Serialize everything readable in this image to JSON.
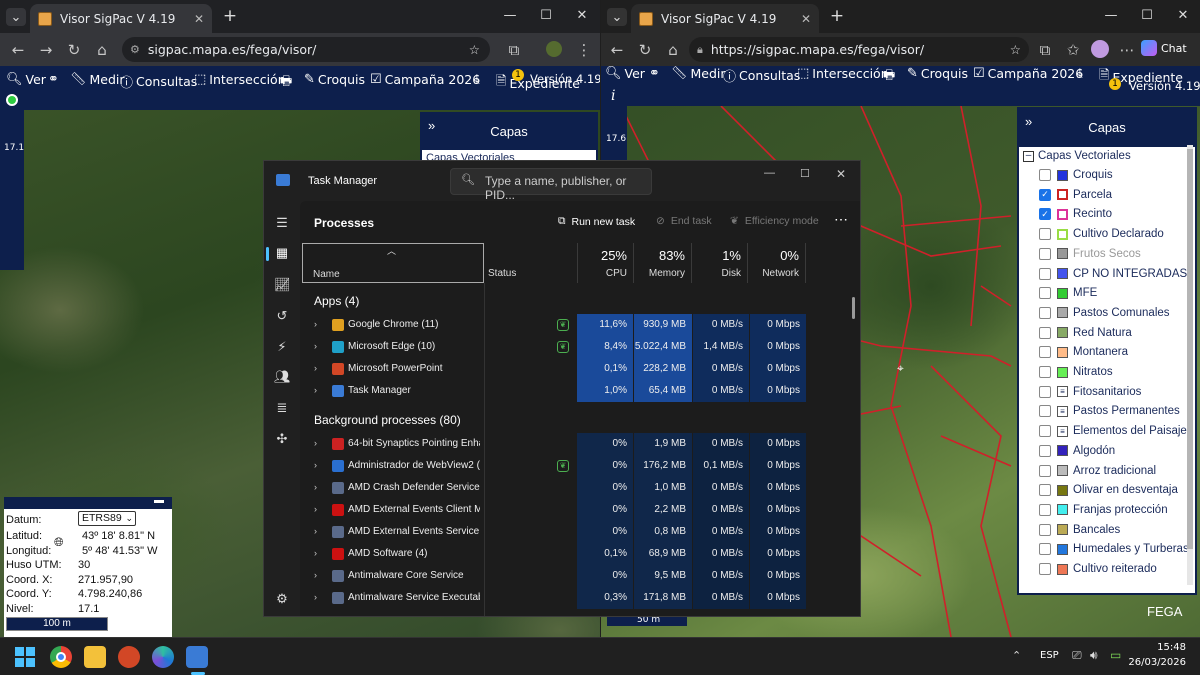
{
  "left_browser": {
    "tab_title": "Visor SigPac V 4.19",
    "url": "sigpac.mapa.es/fega/visor/",
    "toolbar": {
      "ver": "Ver",
      "medir": "Medir",
      "consultas": "Consultas",
      "interseccion": "Intersección",
      "croquis": "Croquis",
      "campana": "Campaña 2026",
      "expediente": "Expediente",
      "version": "Versión 4.19"
    },
    "zoom_level": "17.1",
    "capas_title": "Capas",
    "capas_first": "Capas Vectoriales",
    "scale_bar": "100 m",
    "coords": {
      "datum_label": "Datum:",
      "datum_value": "ETRS89",
      "lat_label": "Latitud:",
      "lat_value": "43º 18' 8.81\" N",
      "lon_label": "Longitud:",
      "lon_value": "5º 48' 41.53\" W",
      "huso_label": "Huso UTM:",
      "huso_value": "30",
      "x_label": "Coord. X:",
      "x_value": "271.957,90",
      "y_label": "Coord. Y:",
      "y_value": "4.798.240,86",
      "nivel_label": "Nivel:",
      "nivel_value": "17.1"
    }
  },
  "right_browser": {
    "tab_title": "Visor SigPac V 4.19",
    "url": "https://sigpac.mapa.es/fega/visor/",
    "copilot": "Chat",
    "toolbar": {
      "ver": "Ver",
      "medir": "Medir",
      "consultas": "Consultas",
      "interseccion": "Intersección",
      "croquis": "Croquis",
      "campana": "Campaña 2026",
      "expediente": "Expediente",
      "version": "Versión 4.19"
    },
    "zoom_level": "17.6",
    "scale_bar": "50 m",
    "watermark": "FEGA",
    "capas": {
      "title": "Capas",
      "group": "Capas Vectoriales",
      "layers": [
        {
          "name": "Croquis",
          "checked": false,
          "color": "#2233dd",
          "filled": true
        },
        {
          "name": "Parcela",
          "checked": true,
          "color": "#cc2222",
          "filled": false
        },
        {
          "name": "Recinto",
          "checked": true,
          "color": "#dd3399",
          "filled": false
        },
        {
          "name": "Cultivo Declarado",
          "checked": false,
          "color": "#99dd44",
          "filled": false
        },
        {
          "name": "Frutos Secos",
          "checked": false,
          "color": "#999999",
          "filled": true,
          "disabled": true
        },
        {
          "name": "CP NO INTEGRADAS",
          "checked": false,
          "color": "#4455ee",
          "filled": true
        },
        {
          "name": "MFE",
          "checked": false,
          "color": "#33cc33",
          "filled": true
        },
        {
          "name": "Pastos Comunales",
          "checked": false,
          "color": "#aaaaaa",
          "filled": true
        },
        {
          "name": "Red Natura",
          "checked": false,
          "color": "#88aa66",
          "filled": true
        },
        {
          "name": "Montanera",
          "checked": false,
          "color": "#ffbb88",
          "filled": true
        },
        {
          "name": "Nitratos",
          "checked": false,
          "color": "#66ee55",
          "filled": true
        },
        {
          "name": "Fitosanitarios",
          "checked": false,
          "color": "#ffffff",
          "filled": true,
          "list": true
        },
        {
          "name": "Pastos Permanentes",
          "checked": false,
          "color": "#ffffff",
          "filled": true,
          "list": true
        },
        {
          "name": "Elementos del Paisaje",
          "checked": false,
          "color": "#ffffff",
          "filled": true,
          "list": true
        },
        {
          "name": "Algodón",
          "checked": false,
          "color": "#3322bb",
          "filled": true
        },
        {
          "name": "Arroz tradicional",
          "checked": false,
          "color": "#bbbbbb",
          "filled": true
        },
        {
          "name": "Olivar en desventaja",
          "checked": false,
          "color": "#777711",
          "filled": true
        },
        {
          "name": "Franjas protección",
          "checked": false,
          "color": "#44eeee",
          "filled": true
        },
        {
          "name": "Bancales",
          "checked": false,
          "color": "#bbaa55",
          "filled": true
        },
        {
          "name": "Humedales y Turberas",
          "checked": false,
          "color": "#2277dd",
          "filled": true
        },
        {
          "name": "Cultivo reiterado",
          "checked": false,
          "color": "#ee7755",
          "filled": true
        }
      ]
    }
  },
  "task_manager": {
    "title": "Task Manager",
    "search_placeholder": "Type a name, publisher, or PID...",
    "section": "Processes",
    "run_new_task": "Run new task",
    "end_task": "End task",
    "efficiency_mode": "Efficiency mode",
    "columns": {
      "name": "Name",
      "status": "Status",
      "cpu_pct": "25%",
      "cpu": "CPU",
      "mem_pct": "83%",
      "mem": "Memory",
      "disk_pct": "1%",
      "disk": "Disk",
      "net_pct": "0%",
      "net": "Network"
    },
    "apps_header": "Apps (4)",
    "bg_header": "Background processes (80)",
    "apps": [
      {
        "name": "Google Chrome (11)",
        "icon": "chrome-icon",
        "color": "#e0a020",
        "eff": true,
        "cpu": "11,6%",
        "mem": "930,9 MB",
        "disk": "0 MB/s",
        "net": "0 Mbps"
      },
      {
        "name": "Microsoft Edge (10)",
        "icon": "edge-icon",
        "color": "#1fa0c8",
        "eff": true,
        "cpu": "8,4%",
        "mem": "5.022,4 MB",
        "disk": "1,4 MB/s",
        "net": "0 Mbps"
      },
      {
        "name": "Microsoft PowerPoint",
        "icon": "powerpoint-icon",
        "color": "#d24726",
        "eff": false,
        "cpu": "0,1%",
        "mem": "228,2 MB",
        "disk": "0 MB/s",
        "net": "0 Mbps"
      },
      {
        "name": "Task Manager",
        "icon": "task-manager-icon",
        "color": "#3a7bd5",
        "eff": false,
        "cpu": "1,0%",
        "mem": "65,4 MB",
        "disk": "0 MB/s",
        "net": "0 Mbps"
      }
    ],
    "background": [
      {
        "name": "64-bit Synaptics Pointing Enha...",
        "icon": "synaptics-icon",
        "color": "#cc2222",
        "eff": false,
        "cpu": "0%",
        "mem": "1,9 MB",
        "disk": "0 MB/s",
        "net": "0 Mbps"
      },
      {
        "name": "Administrador de WebView2 (...",
        "icon": "webview-icon",
        "color": "#2a6fd0",
        "eff": true,
        "cpu": "0%",
        "mem": "176,2 MB",
        "disk": "0,1 MB/s",
        "net": "0 Mbps"
      },
      {
        "name": "AMD Crash Defender Service",
        "icon": "service-icon",
        "color": "#5a6a8a",
        "eff": false,
        "cpu": "0%",
        "mem": "1,0 MB",
        "disk": "0 MB/s",
        "net": "0 Mbps"
      },
      {
        "name": "AMD External Events Client M...",
        "icon": "amd-icon",
        "color": "#cc1111",
        "eff": false,
        "cpu": "0%",
        "mem": "2,2 MB",
        "disk": "0 MB/s",
        "net": "0 Mbps"
      },
      {
        "name": "AMD External Events Service ...",
        "icon": "service-icon",
        "color": "#5a6a8a",
        "eff": false,
        "cpu": "0%",
        "mem": "0,8 MB",
        "disk": "0 MB/s",
        "net": "0 Mbps"
      },
      {
        "name": "AMD Software (4)",
        "icon": "amd-icon",
        "color": "#cc1111",
        "eff": false,
        "cpu": "0,1%",
        "mem": "68,9 MB",
        "disk": "0 MB/s",
        "net": "0 Mbps"
      },
      {
        "name": "Antimalware Core Service",
        "icon": "service-icon",
        "color": "#5a6a8a",
        "eff": false,
        "cpu": "0%",
        "mem": "9,5 MB",
        "disk": "0 MB/s",
        "net": "0 Mbps"
      },
      {
        "name": "Antimalware Service Executable",
        "icon": "service-icon",
        "color": "#5a6a8a",
        "eff": false,
        "cpu": "0,3%",
        "mem": "171,8 MB",
        "disk": "0 MB/s",
        "net": "0 Mbps"
      }
    ]
  },
  "taskbar": {
    "language": "ESP",
    "time": "15:48",
    "date": "26/03/2026",
    "pinned": [
      "windows-start-icon",
      "chrome-icon",
      "file-explorer-icon",
      "powerpoint-icon",
      "edge-dev-icon",
      "task-manager-icon"
    ]
  }
}
